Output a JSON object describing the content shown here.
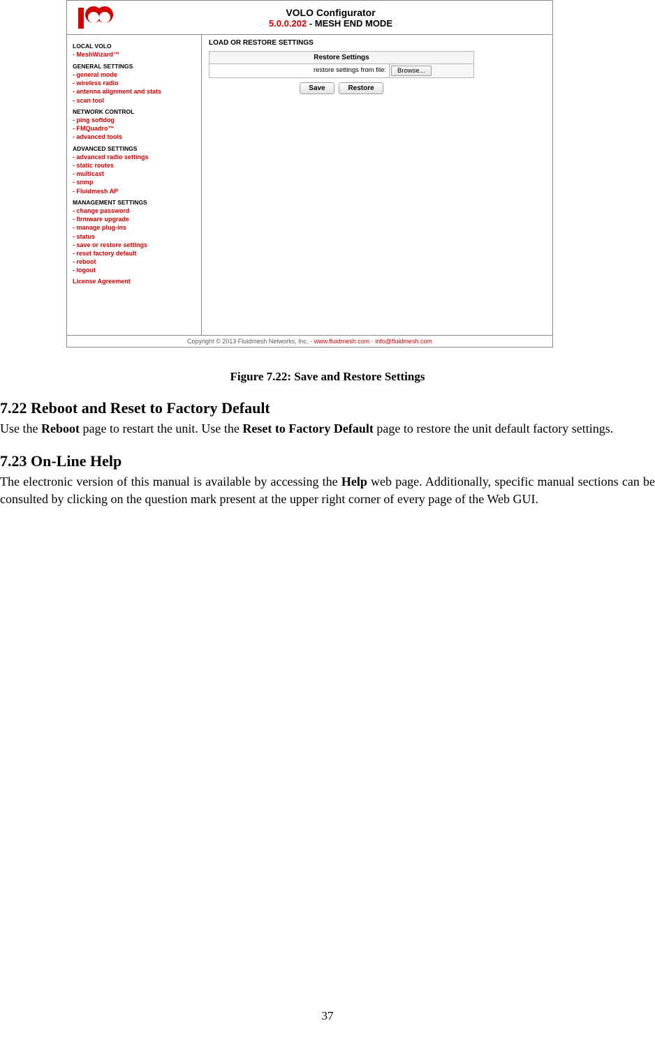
{
  "screenshot": {
    "title": {
      "line1": "VOLO Configurator",
      "version": "5.0.0.202",
      "mode_sep": " - ",
      "mode": "MESH END MODE"
    },
    "sidebar": {
      "sections": [
        {
          "header": "LOCAL VOLO",
          "items": [
            "- MeshWizard™"
          ]
        },
        {
          "header": "GENERAL SETTINGS",
          "items": [
            "- general mode",
            "- wireless radio",
            "- antenna alignment and stats",
            "- scan tool"
          ]
        },
        {
          "header": "NETWORK CONTROL",
          "items": [
            "- ping softdog",
            "- FMQuadro™",
            "- advanced tools"
          ]
        },
        {
          "header": "ADVANCED SETTINGS",
          "items": [
            "- advanced radio settings",
            "- static routes",
            "- multicast",
            "- snmp",
            "- Fluidmesh AP"
          ]
        },
        {
          "header": "MANAGEMENT SETTINGS",
          "items": [
            "- change password",
            "- firmware upgrade",
            "- manage plug-ins",
            "- status",
            "- save or restore settings",
            "- reset factory default",
            "- reboot",
            "- logout"
          ]
        }
      ],
      "license": "License Agreement"
    },
    "content": {
      "section_title": "LOAD OR RESTORE SETTINGS",
      "panel_header": "Restore Settings",
      "row_label": "restore settings from file:",
      "browse_label": "Browse...",
      "save_label": "Save",
      "restore_label": "Restore"
    },
    "footer": {
      "text_black": "Copyright © 2013 Fluidmesh Networks, Inc. - ",
      "link1": "www.fluidmesh.com",
      "sep": " - ",
      "link2": "info@fluidmesh.com"
    }
  },
  "figure_caption": "Figure 7.22:  Save and Restore Settings",
  "section_722": {
    "heading": "7.22 Reboot and Reset to Factory Default",
    "para_parts": {
      "t1": "Use the ",
      "b1": "Reboot",
      "t2": " page to restart the unit.  Use the ",
      "b2": "Reset to Factory Default",
      "t3": " page to restore the unit default factory settings."
    }
  },
  "section_723": {
    "heading": "7.23 On-Line Help",
    "para_parts": {
      "t1": "The electronic version of this manual is available by accessing the ",
      "b1": "Help",
      "t2": " web page.  Additionally, specific manual sections can be consulted by clicking on the question mark present at the upper right corner of every page of the Web GUI."
    }
  },
  "page_number": "37"
}
